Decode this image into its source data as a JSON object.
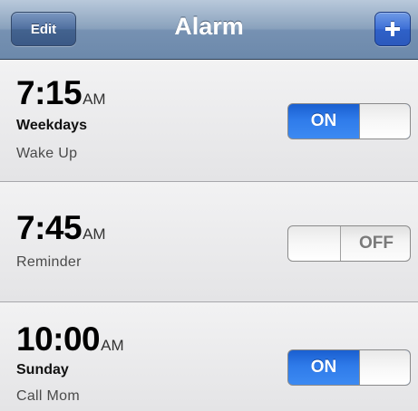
{
  "navbar": {
    "title": "Alarm",
    "edit_label": "Edit",
    "add_icon": "plus-icon"
  },
  "alarms": [
    {
      "time": "7:15",
      "ampm": "AM",
      "days": "Weekdays",
      "label": "Wake Up",
      "enabled": true,
      "switch_text": "ON"
    },
    {
      "time": "7:45",
      "ampm": "AM",
      "days": "",
      "label": "Reminder",
      "enabled": false,
      "switch_text": "OFF"
    },
    {
      "time": "10:00",
      "ampm": "AM",
      "days": "Sunday",
      "label": "Call Mom",
      "enabled": true,
      "switch_text": "ON"
    }
  ],
  "colors": {
    "navbar": "#7691b2",
    "switch_on": "#2f7bea",
    "add_button": "#3d6fd6",
    "row_background": "#ececee"
  }
}
